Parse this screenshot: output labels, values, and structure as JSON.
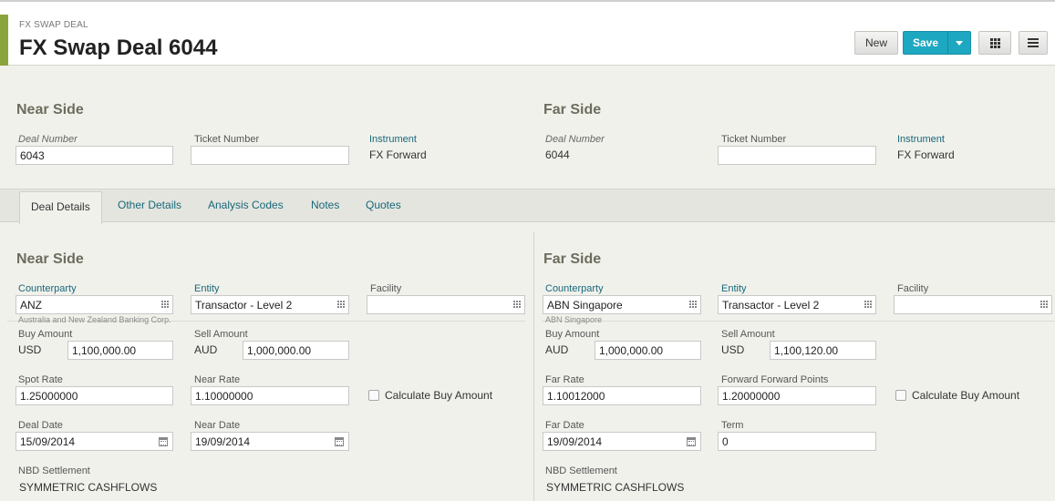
{
  "header": {
    "breadcrumb": "FX SWAP DEAL",
    "title": "FX Swap Deal 6044",
    "new_label": "New",
    "save_label": "Save"
  },
  "top": {
    "near": {
      "title": "Near Side",
      "deal_number_label": "Deal Number",
      "deal_number": "6043",
      "ticket_number_label": "Ticket Number",
      "ticket_number": "",
      "instrument_label": "Instrument",
      "instrument": "FX Forward"
    },
    "far": {
      "title": "Far Side",
      "deal_number_label": "Deal Number",
      "deal_number": "6044",
      "ticket_number_label": "Ticket Number",
      "ticket_number": "",
      "instrument_label": "Instrument",
      "instrument": "FX Forward"
    }
  },
  "tabs": [
    "Deal Details",
    "Other Details",
    "Analysis Codes",
    "Notes",
    "Quotes"
  ],
  "details": {
    "near": {
      "title": "Near Side",
      "counterparty_label": "Counterparty",
      "counterparty": "ANZ",
      "counterparty_sub": "Australia and New Zealand Banking Corp.",
      "entity_label": "Entity",
      "entity": "Transactor - Level 2",
      "facility_label": "Facility",
      "facility": "",
      "buy_amount_label": "Buy Amount",
      "buy_ccy": "USD",
      "buy_amount": "1,100,000.00",
      "sell_amount_label": "Sell Amount",
      "sell_ccy": "AUD",
      "sell_amount": "1,000,000.00",
      "spot_rate_label": "Spot Rate",
      "spot_rate": "1.25000000",
      "near_rate_label": "Near Rate",
      "near_rate": "1.10000000",
      "calc_label": "Calculate Buy Amount",
      "deal_date_label": "Deal Date",
      "deal_date": "15/09/2014",
      "near_date_label": "Near Date",
      "near_date": "19/09/2014",
      "nbd_label": "NBD Settlement",
      "nbd": "SYMMETRIC CASHFLOWS"
    },
    "far": {
      "title": "Far Side",
      "counterparty_label": "Counterparty",
      "counterparty": "ABN Singapore",
      "counterparty_sub": "ABN Singapore",
      "entity_label": "Entity",
      "entity": "Transactor - Level 2",
      "facility_label": "Facility",
      "facility": "",
      "buy_amount_label": "Buy Amount",
      "buy_ccy": "AUD",
      "buy_amount": "1,000,000.00",
      "sell_amount_label": "Sell Amount",
      "sell_ccy": "USD",
      "sell_amount": "1,100,120.00",
      "far_rate_label": "Far Rate",
      "far_rate": "1.10012000",
      "fwd_points_label": "Forward Forward Points",
      "fwd_points": "1.20000000",
      "calc_label": "Calculate Buy Amount",
      "far_date_label": "Far Date",
      "far_date": "19/09/2014",
      "term_label": "Term",
      "term": "0",
      "nbd_label": "NBD Settlement",
      "nbd": "SYMMETRIC CASHFLOWS"
    }
  }
}
